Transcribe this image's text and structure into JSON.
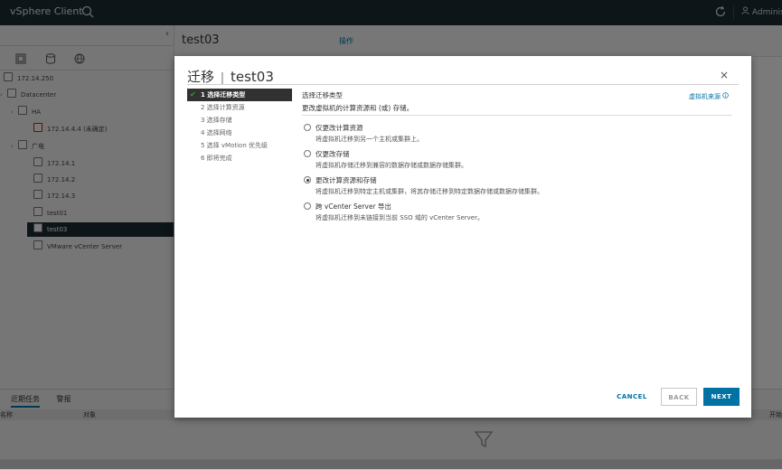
{
  "app": {
    "title": "vSphere Client",
    "user": "Administrator"
  },
  "inventory": {
    "host": "172.14.250",
    "datacenter": "Datacenter",
    "cluster_ha": "HA",
    "host_unknown": "172.14.4.4 (未确定)",
    "cluster_gd": "广电",
    "hosts": [
      "172.14.1",
      "172.14.2",
      "172.14.3"
    ],
    "vm1": "test01",
    "vm_selected": "test03",
    "vcenter": "VMware vCenter Server"
  },
  "right_header": {
    "vm_name": "test03",
    "actions_label": "操作"
  },
  "bottom": {
    "tab_recent": "近期任务",
    "tab_alarms": "警报",
    "col_name": "名称",
    "col_object": "对象",
    "col_start": "开始"
  },
  "modal": {
    "title_prefix": "迁移",
    "title_sep": "|",
    "title_vm": "test03",
    "close": "×",
    "steps": [
      "1 选择迁移类型",
      "2 选择计算资源",
      "3 选择存储",
      "4 选择网络",
      "5 选择 vMotion 优先级",
      "6 即将完成"
    ],
    "heading": "选择迁移类型",
    "subheading": "更改虚拟机的计算资源和 (或) 存储。",
    "source_link": "虚拟机来源",
    "options": [
      {
        "label": "仅更改计算资源",
        "desc": "将虚拟机迁移到另一个主机或集群上。",
        "selected": false
      },
      {
        "label": "仅更改存储",
        "desc": "将虚拟机存储迁移到兼容的数据存储或数据存储集群。",
        "selected": false
      },
      {
        "label": "更改计算资源和存储",
        "desc": "将虚拟机迁移到特定主机或集群，将其存储迁移到特定数据存储或数据存储集群。",
        "selected": true
      },
      {
        "label": "跨 vCenter Server 导出",
        "desc": "将虚拟机迁移到未链接到当前 SSO 域的 vCenter Server。",
        "selected": false
      }
    ],
    "cancel_label": "CANCEL",
    "back_label": "BACK",
    "next_label": "NEXT"
  },
  "colors": {
    "accent": "#0072a3",
    "header_bg": "#1b2a32",
    "active_step_bg": "#313131"
  }
}
